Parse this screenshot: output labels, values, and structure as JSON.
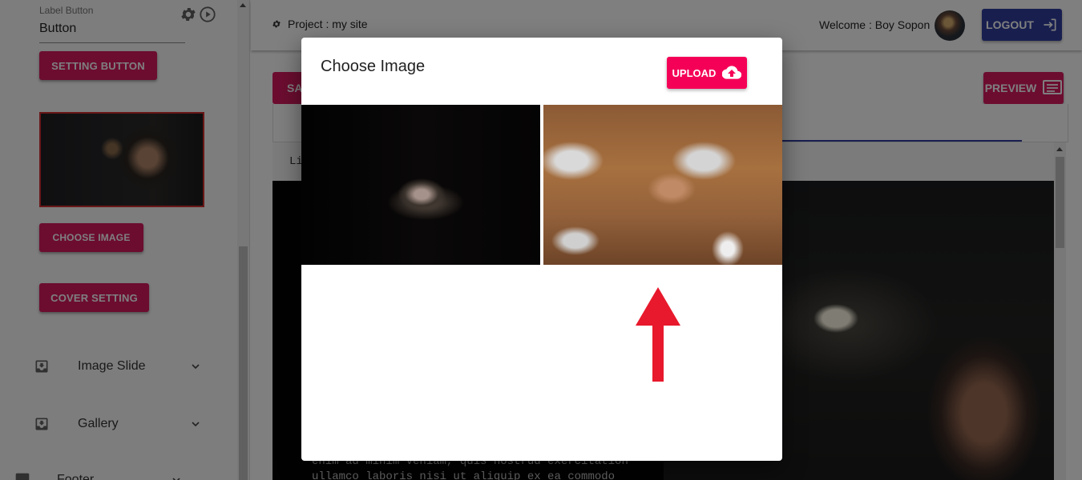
{
  "sidebar": {
    "label_button": {
      "label": "Label Button",
      "value": "Button"
    },
    "setting_button": "SETTING BUTTON",
    "choose_image_button": "CHOOSE IMAGE",
    "cover_setting_button": "COVER SETTING",
    "accordion": [
      {
        "label": "Image Slide",
        "icon": "download-box-icon"
      },
      {
        "label": "Gallery",
        "icon": "download-box-icon"
      },
      {
        "label": "Footer",
        "icon": "box-icon"
      }
    ]
  },
  "topbar": {
    "project": "Project : my site",
    "welcome": "Welcome : Boy Sopon",
    "logout": "LOGOUT"
  },
  "main": {
    "save_fragment": "SA",
    "preview": "PREVIEW",
    "code_fragment": "Li",
    "hero_text": "enim ad minim veniam, quis nostrud exercitation\nullamco laboris nisi ut aliquip ex ea commodo"
  },
  "modal": {
    "title": "Choose Image",
    "upload": "UPLOAD",
    "images": [
      {
        "name": "dark-desk-photo"
      },
      {
        "name": "team-fist-bump-photo"
      }
    ]
  },
  "colors": {
    "pink": "#d81b60",
    "upload_pink": "#f50057",
    "indigo": "#303f9f",
    "arrow_red": "#e8192c"
  }
}
